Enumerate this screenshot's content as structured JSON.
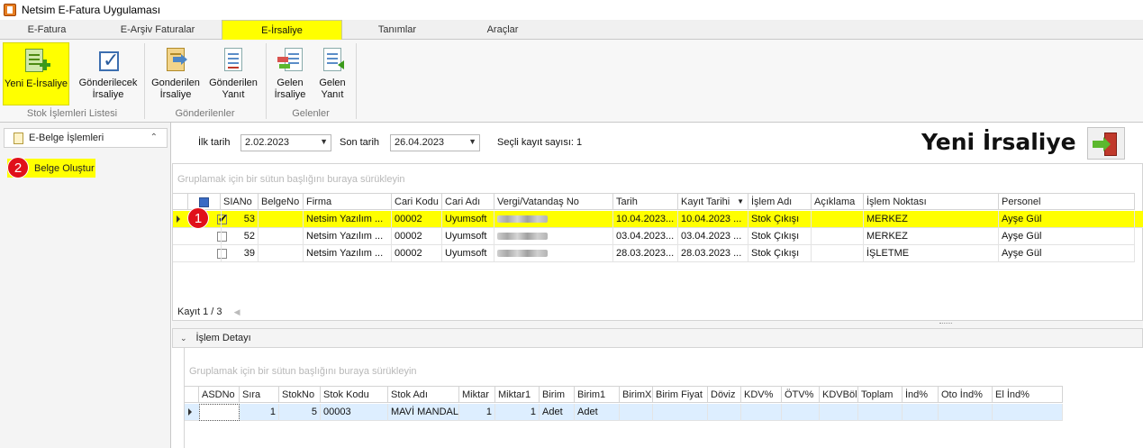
{
  "window": {
    "title": "Netsim E-Fatura Uygulaması"
  },
  "tabs": [
    {
      "label": "E-Fatura",
      "active": false
    },
    {
      "label": "E-Arşiv Faturalar",
      "active": false
    },
    {
      "label": "E-İrsaliye",
      "active": true
    },
    {
      "label": "Tanımlar",
      "active": false
    },
    {
      "label": "Araçlar",
      "active": false
    }
  ],
  "ribbon": {
    "groups": [
      {
        "label": "Stok İşlemleri Listesi"
      },
      {
        "label": "Gönderilenler"
      },
      {
        "label": "Gelenler"
      }
    ],
    "buttons": {
      "yeni_irsaliye": "Yeni E-İrsaliye",
      "gonderilecek_1": "Gönderilecek",
      "gonderilecek_2": "İrsaliye",
      "gonderilen_irs_1": "Gonderilen",
      "gonderilen_irs_2": "İrsaliye",
      "gonderilen_yanit_1": "Gönderilen",
      "gonderilen_yanit_2": "Yanıt",
      "gelen_irs_1": "Gelen",
      "gelen_irs_2": "İrsaliye",
      "gelen_yanit_1": "Gelen",
      "gelen_yanit_2": "Yanıt"
    }
  },
  "left_panel": {
    "header": "E-Belge İşlemleri",
    "items": [
      {
        "label": "Belge Oluştur"
      }
    ]
  },
  "annotations": {
    "badge1": "1",
    "badge2": "2"
  },
  "filters": {
    "start_label": "İlk tarih",
    "start_value": "2.02.2023",
    "end_label": "Son tarih",
    "end_value": "26.04.2023",
    "count_text": "Seçli kayıt sayısı: 1"
  },
  "page_heading": "Yeni İrsaliye",
  "grid": {
    "group_hint": "Gruplamak için bir sütun başlığını buraya sürükleyin",
    "columns": [
      "SIANo",
      "BelgeNo",
      "Firma",
      "Cari Kodu",
      "Cari Adı",
      "Vergi/Vatandaş No",
      "Tarih",
      "Kayıt Tarihi",
      "İşlem Adı",
      "Açıklama",
      "İşlem Noktası",
      "Personel"
    ],
    "rows": [
      {
        "checked": true,
        "selected": true,
        "siano": "53",
        "belgeno": "",
        "firma": "Netsim Yazılım ...",
        "cari_kodu": "00002",
        "cari_adi": "Uyumsoft",
        "tarih": "10.04.2023...",
        "kayit_tarihi": "10.04.2023 ...",
        "islem_adi": "Stok Çıkışı",
        "aciklama": "",
        "islem_noktasi": "MERKEZ",
        "personel": "Ayşe Gül"
      },
      {
        "checked": false,
        "selected": false,
        "siano": "52",
        "belgeno": "",
        "firma": "Netsim Yazılım ...",
        "cari_kodu": "00002",
        "cari_adi": "Uyumsoft",
        "tarih": "03.04.2023...",
        "kayit_tarihi": "03.04.2023 ...",
        "islem_adi": "Stok Çıkışı",
        "aciklama": "",
        "islem_noktasi": "MERKEZ",
        "personel": "Ayşe Gül"
      },
      {
        "checked": false,
        "selected": false,
        "siano": "39",
        "belgeno": "",
        "firma": "Netsim Yazılım ...",
        "cari_kodu": "00002",
        "cari_adi": "Uyumsoft",
        "tarih": "28.03.2023...",
        "kayit_tarihi": "28.03.2023 ...",
        "islem_adi": "Stok Çıkışı",
        "aciklama": "",
        "islem_noktasi": "İŞLETME",
        "personel": "Ayşe Gül"
      }
    ],
    "footer": "Kayıt 1 / 3"
  },
  "detail": {
    "title": "İşlem Detayı",
    "group_hint": "Gruplamak için bir sütun başlığını buraya sürükleyin",
    "columns": [
      "ASDNo",
      "Sıra",
      "StokNo",
      "Stok Kodu",
      "Stok Adı",
      "Miktar",
      "Miktar1",
      "Birim",
      "Birim1",
      "BirimX",
      "Birim Fiyat",
      "Döviz",
      "KDV%",
      "ÖTV%",
      "KDVBöl",
      "Toplam",
      "İnd%",
      "Oto İnd%",
      "El İnd%"
    ],
    "row": {
      "asdno": "",
      "sira": "1",
      "stokno": "5",
      "stok_kodu": "00003",
      "stok_adi": "MAVİ MANDAL",
      "miktar": "1",
      "miktar1": "1",
      "birim": "Adet",
      "birim1": "Adet"
    }
  },
  "colors": {
    "highlight": "#ffff00",
    "badge": "#e0101a",
    "detail_row": "#ddeeff"
  }
}
